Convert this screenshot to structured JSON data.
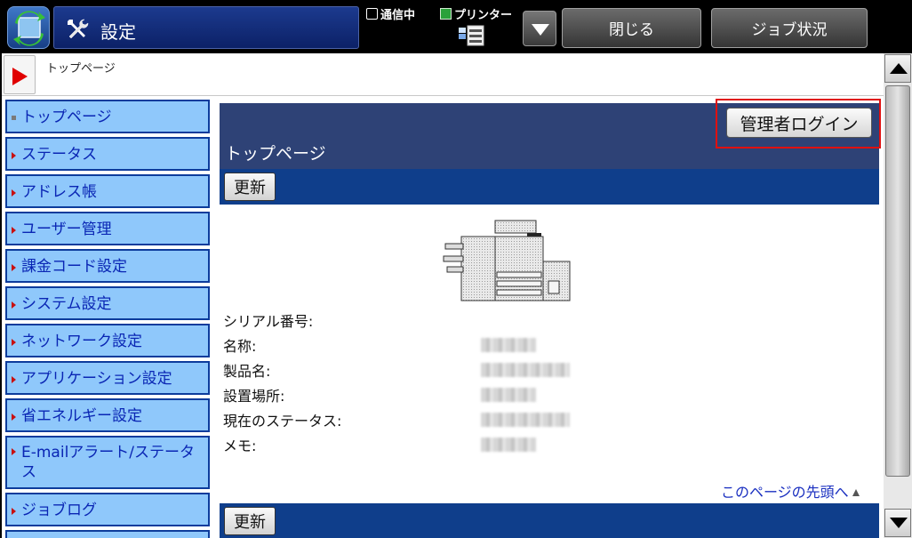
{
  "header": {
    "title": "設定",
    "status_comm": "通信中",
    "status_printer": "プリンター",
    "close_label": "閉じる",
    "job_status_label": "ジョブ状況"
  },
  "breadcrumb": {
    "text": "トップページ"
  },
  "sidebar": {
    "items": [
      {
        "label": "トップページ"
      },
      {
        "label": "ステータス"
      },
      {
        "label": "アドレス帳"
      },
      {
        "label": "ユーザー管理"
      },
      {
        "label": "課金コード設定"
      },
      {
        "label": "システム設定"
      },
      {
        "label": "ネットワーク設定"
      },
      {
        "label": "アプリケーション設定"
      },
      {
        "label": "省エネルギー設定"
      },
      {
        "label": "E-mailアラート/ステータス"
      },
      {
        "label": "ジョブログ"
      }
    ]
  },
  "main": {
    "admin_login_label": "管理者ログイン",
    "heading": "トップページ",
    "refresh_label": "更新",
    "info_rows": [
      {
        "label": "シリアル番号:"
      },
      {
        "label": "名称:"
      },
      {
        "label": "製品名:"
      },
      {
        "label": "設置場所:"
      },
      {
        "label": "現在のステータス:"
      },
      {
        "label": "メモ:"
      }
    ],
    "top_link": "このページの先頭へ"
  },
  "colors": {
    "accent_red": "#e01010",
    "header_navy": "#2e4276",
    "bar_blue": "#0f3e8b",
    "sidebar_fill": "#8fc8fb",
    "link_blue": "#1a2fc0"
  }
}
